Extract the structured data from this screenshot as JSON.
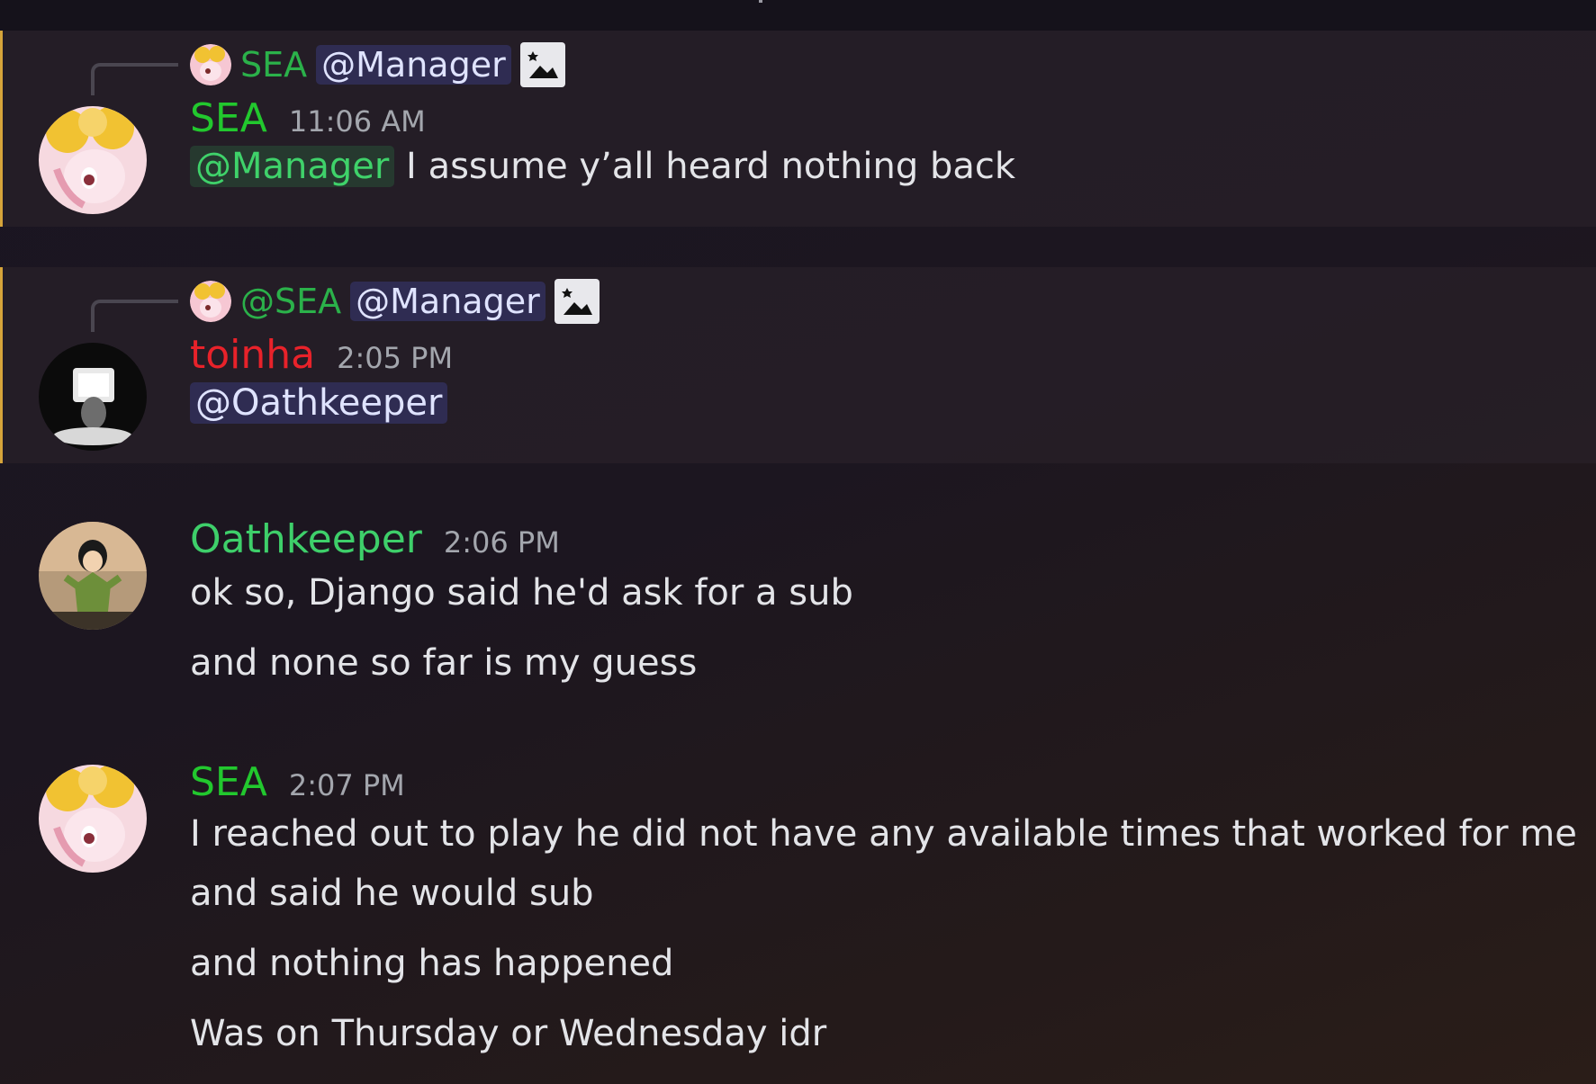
{
  "colors": {
    "sea_green": "#22c82e",
    "reply_green": "#2bb14a",
    "toinha_red": "#e8222a",
    "oathkeeper_green": "#3ecf6a",
    "new_message_bar": "#d6a43a"
  },
  "messages": [
    {
      "reply": {
        "name": "SEA",
        "mention": "@Manager"
      },
      "author": "SEA",
      "timestamp": "11:06 AM",
      "mention": "@Manager",
      "text": " I assume y’all heard nothing back"
    },
    {
      "reply": {
        "name": "@SEA",
        "mention": "@Manager"
      },
      "author": "toinha",
      "timestamp": "2:05 PM",
      "mention": "@Oathkeeper"
    },
    {
      "author": "Oathkeeper",
      "timestamp": "2:06 PM",
      "lines": [
        "ok so, Django said he'd ask for a sub",
        "and none so far is my guess"
      ]
    },
    {
      "author": "SEA",
      "timestamp": "2:07 PM",
      "lines": [
        "I reached out to play he did not have any available times that worked for me",
        "and said he would sub",
        "and nothing has happened",
        "Was on Thursday or Wednesday idr"
      ]
    }
  ]
}
